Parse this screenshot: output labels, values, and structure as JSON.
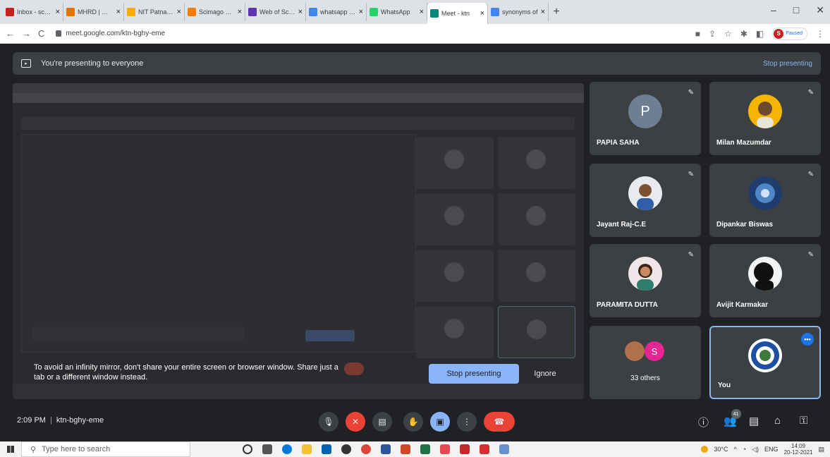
{
  "browser": {
    "tabs": [
      {
        "label": "Inbox - scollis",
        "color": "#c5221f"
      },
      {
        "label": "MHRD | MHRD",
        "color": "#e37400"
      },
      {
        "label": "NIT Patna | N",
        "color": "#f9ab00"
      },
      {
        "label": "Scimago Journ",
        "color": "#f57c00"
      },
      {
        "label": "Web of Scienc",
        "color": "#5e35b1"
      },
      {
        "label": "whatsapp web",
        "color": "#4285f4"
      },
      {
        "label": "WhatsApp",
        "color": "#25d366"
      },
      {
        "label": "Meet - ktn",
        "color": "#00897b",
        "active": true
      },
      {
        "label": "synonyms of",
        "color": "#4285f4"
      }
    ],
    "tab_close": "×",
    "new_tab": "+",
    "url": "meet.google.com/ktn-bghy-eme",
    "profile_initial": "S",
    "profile_label": "Paused"
  },
  "banner": {
    "text": "You're presenting to everyone",
    "stop_label": "Stop presenting"
  },
  "warning": {
    "text": "To avoid an infinity mirror, don't share your entire screen or browser window. Share just a tab or a different window instead.",
    "stop_button": "Stop presenting",
    "ignore_button": "Ignore"
  },
  "participants": [
    {
      "name": "PAPIA SAHA",
      "initial": "P",
      "avatar_color": "#6e7f93"
    },
    {
      "name": "Milan Mazumdar",
      "avatar_color": "#f4b400"
    },
    {
      "name": "Jayant Raj-C.E",
      "avatar_color": "#e8eaed"
    },
    {
      "name": "Dipankar Biswas",
      "avatar_color": "#1e3c6e"
    },
    {
      "name": "PARAMITA DUTTA",
      "avatar_color": "#f0e6e8"
    },
    {
      "name": "Avijit Karmakar",
      "avatar_color": "#f1f3f4"
    },
    {
      "name": "",
      "others": "33 others",
      "initial": "S",
      "avatar_color": "#e52592"
    },
    {
      "name": "You",
      "avatar_color": "#ffffff"
    }
  ],
  "meeting": {
    "time": "2:09 PM",
    "code": "ktn-bghy-eme",
    "participant_count": "41"
  },
  "taskbar": {
    "search_placeholder": "Type here to search",
    "weather": "30°C",
    "lang": "ENG",
    "time": "14:09",
    "date": "20-12-2021"
  }
}
